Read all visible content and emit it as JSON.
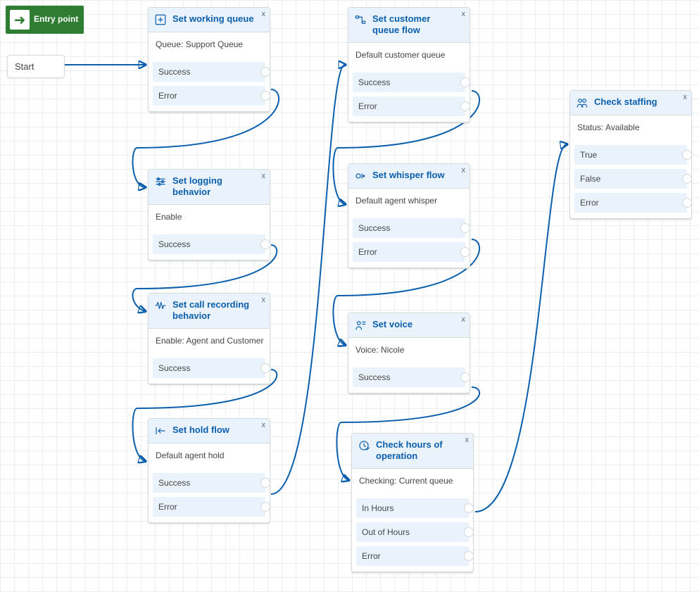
{
  "entry": {
    "label": "Entry point"
  },
  "start": {
    "label": "Start"
  },
  "nodes": {
    "workingQueue": {
      "title": "Set working queue",
      "desc": "Queue: Support Queue",
      "ports": [
        "Success",
        "Error"
      ]
    },
    "logging": {
      "title": "Set logging behavior",
      "desc": "Enable",
      "ports": [
        "Success"
      ]
    },
    "recording": {
      "title": "Set call recording behavior",
      "desc": "Enable: Agent and Customer",
      "ports": [
        "Success"
      ]
    },
    "holdFlow": {
      "title": "Set hold flow",
      "desc": "Default agent hold",
      "ports": [
        "Success",
        "Error"
      ]
    },
    "custQueueFlow": {
      "title": "Set customer queue flow",
      "desc": "Default customer queue",
      "ports": [
        "Success",
        "Error"
      ]
    },
    "whisper": {
      "title": "Set whisper flow",
      "desc": "Default agent whisper",
      "ports": [
        "Success",
        "Error"
      ]
    },
    "voice": {
      "title": "Set voice",
      "desc": "Voice: Nicole",
      "ports": [
        "Success"
      ]
    },
    "hours": {
      "title": "Check hours of operation",
      "desc": "Checking: Current queue",
      "ports": [
        "In Hours",
        "Out of Hours",
        "Error"
      ]
    },
    "staffing": {
      "title": "Check staffing",
      "desc": "Status: Available",
      "ports": [
        "True",
        "False",
        "Error"
      ]
    }
  },
  "close_label": "x"
}
